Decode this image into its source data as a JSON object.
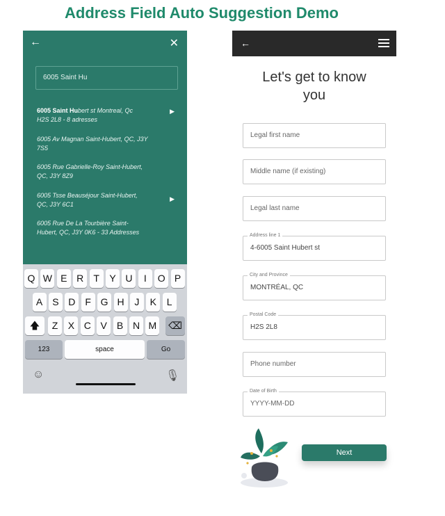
{
  "title": "Address Field Auto Suggestion Demo",
  "left_phone": {
    "search_value": "6005 Saint Hu",
    "suggestions": [
      {
        "bold": "6005 Saint Hu",
        "rest": "bert st  Montreal, Qc",
        "line2": "H2S 2L8  - 8 adresses"
      },
      {
        "bold": "",
        "rest": "6005 Av Magnan Saint-Hubert, QC, J3Y",
        "line2": "7S5"
      },
      {
        "bold": "",
        "rest": "6005 Rue Gabrielle-Roy   Saint-Hubert,",
        "line2": "QC, J3Y 8Z9"
      },
      {
        "bold": "",
        "rest": "6005 Tsse Beauséjour Saint-Hubert,",
        "line2": "QC, J3Y 6C1"
      },
      {
        "bold": "",
        "rest": "6005 Rue De La Tourbière   Saint-",
        "line2": "Hubert, QC, J3Y 0K6 - 33 Addresses"
      }
    ],
    "keyboard": {
      "row1": [
        "Q",
        "W",
        "E",
        "R",
        "T",
        "Y",
        "U",
        "I",
        "O",
        "P"
      ],
      "row2": [
        "A",
        "S",
        "D",
        "F",
        "G",
        "H",
        "J",
        "K",
        "L"
      ],
      "row3": [
        "Z",
        "X",
        "C",
        "V",
        "B",
        "N",
        "M"
      ],
      "num_label": "123",
      "space_label": "space",
      "go_label": "Go"
    }
  },
  "right_phone": {
    "heading_line1": "Let's get to know",
    "heading_line2": "you",
    "fields": {
      "first_name": {
        "placeholder": "Legal first name"
      },
      "middle_name": {
        "placeholder": "Middle name (if existing)"
      },
      "last_name": {
        "placeholder": "Legal last name"
      },
      "address": {
        "label": "Address line 1",
        "value": "4-6005 Saint Hubert st"
      },
      "city": {
        "label": "City and Province",
        "value": "MONTRÉAL, QC"
      },
      "postal": {
        "label": "Postal Code",
        "value": "H2S 2L8"
      },
      "phone": {
        "placeholder": "Phone number"
      },
      "dob": {
        "label": "Date of Birth",
        "placeholder": "YYYY-MM-DD"
      }
    },
    "next_label": "Next"
  },
  "colors": {
    "accent": "#2b7a6a",
    "title": "#1f8a6b",
    "topbar": "#292929"
  }
}
